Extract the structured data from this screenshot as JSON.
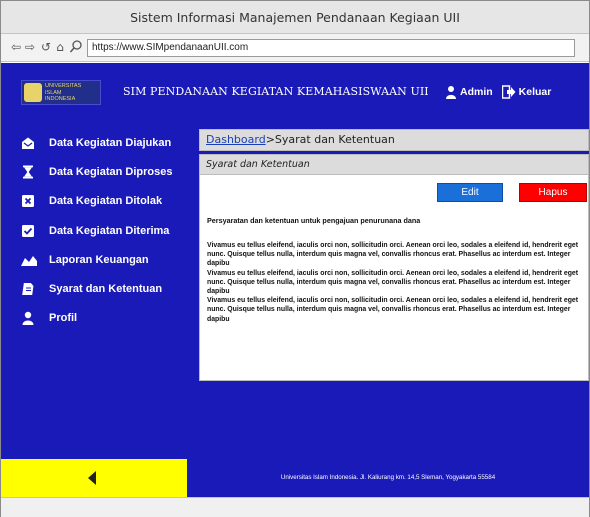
{
  "window": {
    "title": "Sistem Informasi Manajemen Pendanaan Kegiaan UII"
  },
  "browser": {
    "url": "https://www.SIMpendanaanUII.com"
  },
  "header": {
    "logo_text_line1": "UNIVERSITAS",
    "logo_text_line2": "ISLAM",
    "logo_text_line3": "INDONESIA",
    "app_title": "SIM PENDANAAN KEGIATAN KEMAHASISWAAN UII",
    "admin_label": "Admin",
    "logout_label": "Keluar"
  },
  "sidebar": {
    "items": [
      {
        "label": "Data Kegiatan Diajukan",
        "icon": "inbox-icon"
      },
      {
        "label": "Data Kegiatan Diproses",
        "icon": "hourglass-icon"
      },
      {
        "label": "Data Kegiatan Ditolak",
        "icon": "x-box-icon"
      },
      {
        "label": "Data Kegiatan Diterima",
        "icon": "check-box-icon"
      },
      {
        "label": "Laporan Keuangan",
        "icon": "chart-area-icon"
      },
      {
        "label": "Syarat dan Ketentuan",
        "icon": "document-icon"
      },
      {
        "label": "Profil",
        "icon": "user-icon"
      }
    ]
  },
  "breadcrumb": {
    "root": "Dashboard",
    "separator": ">",
    "current": "Syarat dan Ketentuan"
  },
  "panel": {
    "title": "Syarat dan Ketentuan",
    "edit_label": "Edit",
    "delete_label": "Hapus",
    "subtitle": "Persyaratan dan ketentuan untuk pengajuan penurunana dana",
    "paragraphs": [
      "Vivamus eu tellus eleifend, iaculis orci non, sollicitudin orci. Aenean orci leo, sodales a eleifend id, hendrerit eget nunc. Quisque tellus nulla, interdum quis magna vel, convallis rhoncus erat. Phasellus ac interdum est. Integer dapibu",
      "Vivamus eu tellus eleifend, iaculis orci non, sollicitudin orci. Aenean orci leo, sodales a eleifend id, hendrerit eget nunc. Quisque tellus nulla, interdum quis magna vel, convallis rhoncus erat. Phasellus ac interdum est. Integer dapibu",
      "Vivamus eu tellus eleifend, iaculis orci non, sollicitudin orci. Aenean orci leo, sodales a eleifend id, hendrerit eget nunc. Quisque tellus nulla, interdum quis magna vel, convallis rhoncus erat. Phasellus ac interdum est. Integer dapibu"
    ]
  },
  "footer": {
    "address": "Universitas Islam Indonesia. Jl. Kaliurang km. 14,5 Sleman, Yogyakarta 55584"
  },
  "colors": {
    "primary": "#1a1ab8",
    "edit": "#1b6fd8",
    "delete": "#ff0000",
    "footer_left": "#ffff00"
  }
}
